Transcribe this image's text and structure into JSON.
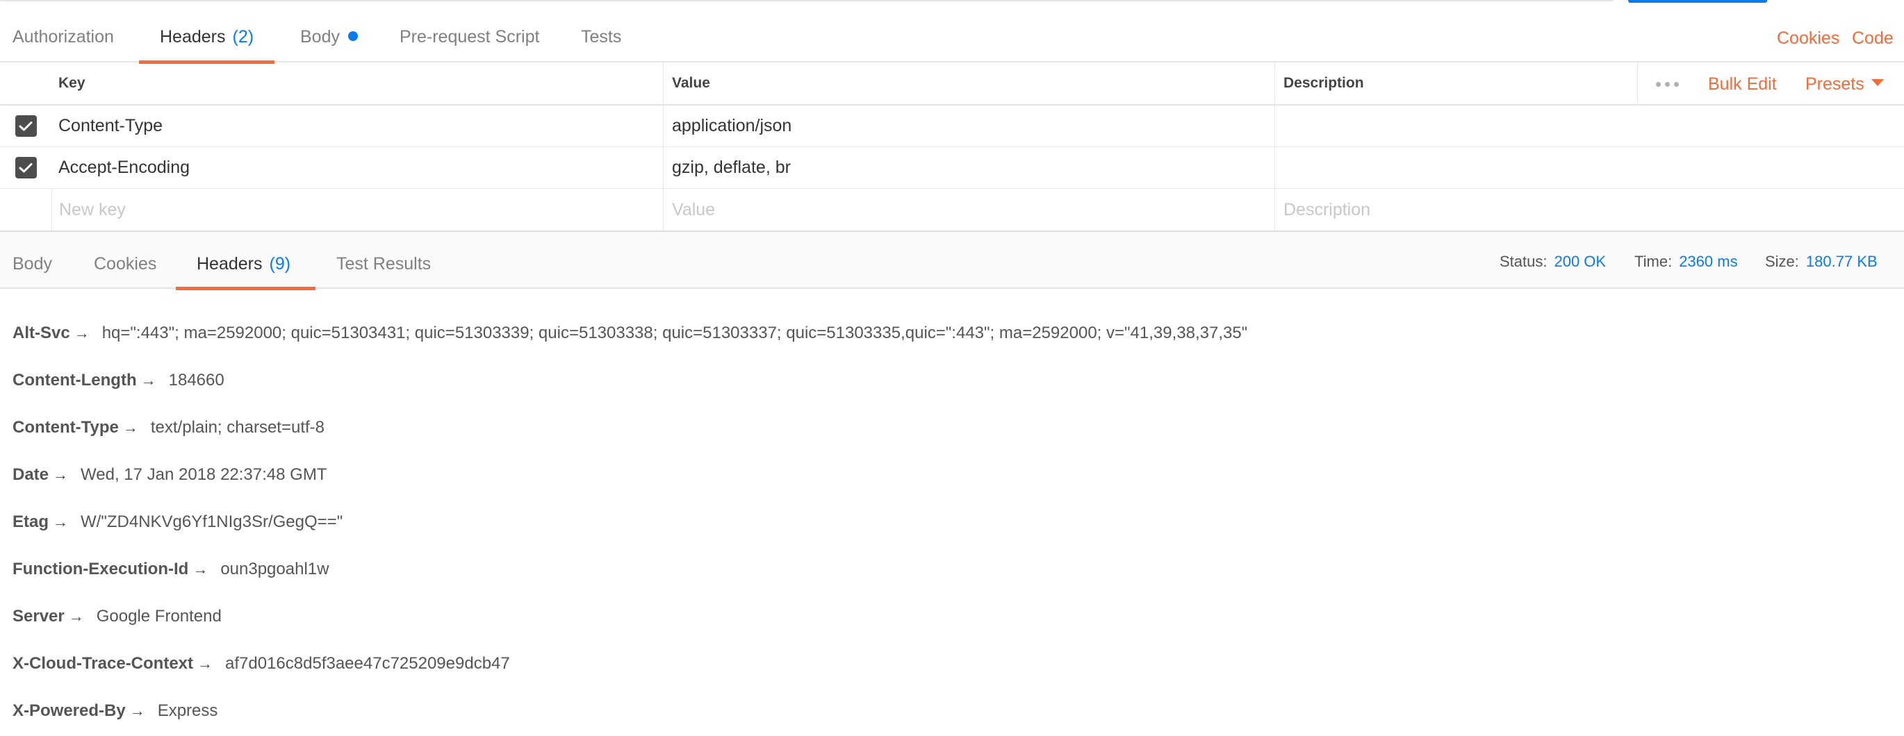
{
  "request_tabs": {
    "authorization": "Authorization",
    "headers_label": "Headers",
    "headers_count": "(2)",
    "body": "Body",
    "prerequest": "Pre-request Script",
    "tests": "Tests",
    "cookies_link": "Cookies",
    "code_link": "Code"
  },
  "headers_table": {
    "columns": {
      "key": "Key",
      "value": "Value",
      "description": "Description"
    },
    "bulk_edit": "Bulk Edit",
    "presets": "Presets",
    "rows": [
      {
        "key": "Content-Type",
        "value": "application/json",
        "description": "",
        "checked": true
      },
      {
        "key": "Accept-Encoding",
        "value": "gzip, deflate, br",
        "description": "",
        "checked": true
      }
    ],
    "new_row": {
      "key_placeholder": "New key",
      "value_placeholder": "Value",
      "description_placeholder": "Description"
    }
  },
  "response_tabs": {
    "body": "Body",
    "cookies": "Cookies",
    "headers_label": "Headers",
    "headers_count": "(9)",
    "test_results": "Test Results"
  },
  "response_meta": {
    "status_label": "Status:",
    "status_value": "200 OK",
    "time_label": "Time:",
    "time_value": "2360 ms",
    "size_label": "Size:",
    "size_value": "180.77 KB"
  },
  "response_headers": [
    {
      "key": "Alt-Svc",
      "value": "hq=\":443\"; ma=2592000; quic=51303431; quic=51303339; quic=51303338; quic=51303337; quic=51303335,quic=\":443\"; ma=2592000; v=\"41,39,38,37,35\""
    },
    {
      "key": "Content-Length",
      "value": "184660"
    },
    {
      "key": "Content-Type",
      "value": "text/plain; charset=utf-8"
    },
    {
      "key": "Date",
      "value": "Wed, 17 Jan 2018 22:37:48 GMT"
    },
    {
      "key": "Etag",
      "value": "W/\"ZD4NKVg6Yf1NIg3Sr/GegQ==\""
    },
    {
      "key": "Function-Execution-Id",
      "value": "oun3pgoahl1w"
    },
    {
      "key": "Server",
      "value": "Google Frontend"
    },
    {
      "key": "X-Cloud-Trace-Context",
      "value": "af7d016c8d5f3aee47c725209e9dcb47"
    },
    {
      "key": "X-Powered-By",
      "value": "Express"
    }
  ],
  "arrow_glyph": "→",
  "colors": {
    "accent_orange": "#f26b3a",
    "accent_blue": "#097bed",
    "checkbox": "#4d4d4d"
  }
}
